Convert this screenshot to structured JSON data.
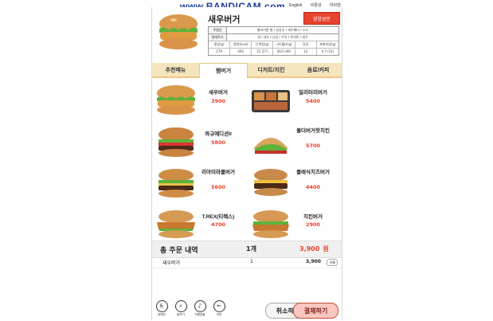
{
  "watermark": "www.BANDICAM.com",
  "top_strip": [
    "English",
    "비활성",
    "미비점"
  ],
  "header": {
    "title": "새우버거",
    "nutrition_button": "영양성분",
    "info": [
      {
        "k": "주원산",
        "v": "햄버거용 빵 / 양상추 / 새우패티 / 소스"
      },
      {
        "k": "알레르기",
        "v": "밀 / 대두 / 난류 / 우유 / 토마토 / 새우"
      }
    ],
    "nut_headers": [
      "중량(g)",
      "열량(kcal)",
      "단백질(g)",
      "나트륨(mg)",
      "당류",
      "포화지방(g)"
    ],
    "nut_values": [
      "179",
      "492",
      "15 (27)",
      "810 (40)",
      "12",
      "4.7 (31)"
    ]
  },
  "tabs": [
    "추천메뉴",
    "햄버거",
    "디저트/치킨",
    "음료/커피"
  ],
  "active_tab": 1,
  "menu": [
    {
      "name": "새우버거",
      "price": "3900"
    },
    {
      "name": "밀리터리버거",
      "price": "5400"
    },
    {
      "name": "와규에디션II",
      "price": "5800"
    },
    {
      "name": "폴더버거핫치킨",
      "price": "5700"
    },
    {
      "name": "리아미라클버거",
      "price": "5600"
    },
    {
      "name": "클래식치즈버거",
      "price": "4400"
    },
    {
      "name": "T.REX(티렉스)",
      "price": "4700"
    },
    {
      "name": "치킨버거",
      "price": "2900"
    }
  ],
  "summary": {
    "title": "총 주문 내역",
    "count": "1개",
    "total": "3,900",
    "currency": "원"
  },
  "orders": [
    {
      "name": "새우버거",
      "qty": "1",
      "price": "3,900",
      "delete": "삭제"
    }
  ],
  "bottom": {
    "icons": [
      {
        "label": "장애인",
        "icon": "wheelchair-icon"
      },
      {
        "label": "돋보기",
        "icon": "magnifier-icon"
      },
      {
        "label": "직원호출",
        "icon": "bell-icon"
      },
      {
        "label": "이전",
        "icon": "back-arrow-icon"
      }
    ],
    "cancel": "취소하기",
    "pay": "결제하기"
  },
  "colors": {
    "accent": "#e8412c",
    "tab_bg": "#f6e4bf",
    "pay_bg": "#f7c7c0"
  }
}
